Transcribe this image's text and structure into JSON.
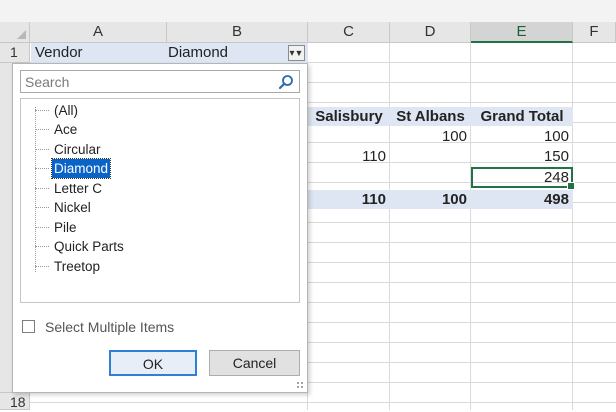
{
  "columns": [
    "A",
    "B",
    "C",
    "D",
    "E",
    "F"
  ],
  "rows": {
    "r1": "1",
    "r18": "18"
  },
  "a1": {
    "vendor_label": "Vendor",
    "filter_value": "Diamond"
  },
  "pivot": {
    "headers": [
      "Salisbury",
      "St Albans",
      "Grand Total"
    ],
    "data_rows": [
      {
        "salisbury": "",
        "st_albans": "100",
        "grand_total": "100"
      },
      {
        "salisbury": "110",
        "st_albans": "",
        "grand_total": "150"
      },
      {
        "salisbury": "",
        "st_albans": "",
        "grand_total": "248"
      }
    ],
    "total_row": {
      "salisbury": "110",
      "st_albans": "100",
      "grand_total": "498"
    }
  },
  "filter_panel": {
    "search_placeholder": "Search",
    "items": [
      "(All)",
      "Ace",
      "Circular",
      "Diamond",
      "Letter C",
      "Nickel",
      "Pile",
      "Quick Parts",
      "Treetop"
    ],
    "selected_item": "Diamond",
    "multi_select_label": "Select Multiple Items",
    "multi_select_checked": false,
    "ok_label": "OK",
    "cancel_label": "Cancel"
  },
  "colors": {
    "accent": "#217346",
    "selection": "#0a64c8",
    "header_fill": "#dde6f2"
  }
}
